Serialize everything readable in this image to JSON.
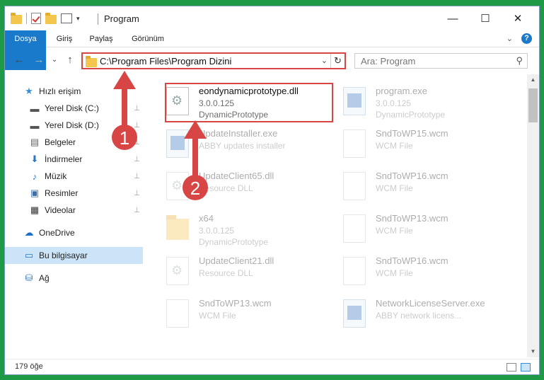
{
  "window": {
    "title": "Program",
    "controls": {
      "minimize": "—",
      "maximize": "☐",
      "close": "✕"
    }
  },
  "ribbon": {
    "tabs": [
      "Dosya",
      "Giriş",
      "Paylaş",
      "Görünüm"
    ],
    "help": "?",
    "collapse": "⌄"
  },
  "nav": {
    "back": "←",
    "forward": "→",
    "recent": "⌄",
    "up": "↑",
    "address": "C:\\Program Files\\Program Dizini",
    "address_dropdown": "⌄",
    "refresh": "↻",
    "search_placeholder": "Ara: Program",
    "search_icon": "⚲"
  },
  "sidebar": {
    "items": [
      {
        "label": "Hızlı erişim",
        "icon": "star-icon",
        "glyph": "★",
        "color": "#3b8ed6",
        "pinned": false
      },
      {
        "label": "Yerel Disk (C:)",
        "icon": "drive-icon",
        "glyph": "▬",
        "color": "#555",
        "pinned": true
      },
      {
        "label": "Yerel Disk (D:)",
        "icon": "drive-icon",
        "glyph": "▬",
        "color": "#555",
        "pinned": true
      },
      {
        "label": "Belgeler",
        "icon": "documents-icon",
        "glyph": "▤",
        "color": "#666",
        "pinned": true
      },
      {
        "label": "İndirmeler",
        "icon": "download-icon",
        "glyph": "⬇",
        "color": "#2a77c6",
        "pinned": true
      },
      {
        "label": "Müzik",
        "icon": "music-icon",
        "glyph": "♪",
        "color": "#2a77c6",
        "pinned": true
      },
      {
        "label": "Resimler",
        "icon": "pictures-icon",
        "glyph": "▣",
        "color": "#3a6ea5",
        "pinned": true
      },
      {
        "label": "Videolar",
        "icon": "video-icon",
        "glyph": "▦",
        "color": "#333",
        "pinned": true
      },
      {
        "label": "OneDrive",
        "icon": "onedrive-icon",
        "glyph": "☁",
        "color": "#1a6fc7",
        "pinned": false
      },
      {
        "label": "Bu bilgisayar",
        "icon": "computer-icon",
        "glyph": "▭",
        "color": "#2a77c6",
        "pinned": false,
        "selected": true
      },
      {
        "label": "Ağ",
        "icon": "network-icon",
        "glyph": "⛁",
        "color": "#2a77c6",
        "pinned": false
      }
    ],
    "pin_glyph": "📌"
  },
  "files": [
    {
      "name": "eondynamicprototype.dll",
      "line2": "3.0.0.125",
      "line3": "DynamicPrototype",
      "kind": "dll",
      "faded": false
    },
    {
      "name": "program.exe",
      "line2": "3.0.0.125",
      "line3": "DynamicPrototype",
      "kind": "exe",
      "faded": true
    },
    {
      "name": "UpdateInstaller.exe",
      "line2": "ABBY updates installer",
      "line3": "",
      "kind": "exe",
      "faded": true
    },
    {
      "name": "SndToWP15.wcm",
      "line2": "WCM File",
      "line3": "",
      "kind": "doc",
      "faded": true
    },
    {
      "name": "UpdateClient65.dll",
      "line2": "Resource DLL",
      "line3": "",
      "kind": "dll",
      "faded": true
    },
    {
      "name": "SndToWP16.wcm",
      "line2": "WCM File",
      "line3": "",
      "kind": "doc",
      "faded": true
    },
    {
      "name": "x64",
      "line2": "3.0.0.125",
      "line3": "DynamicPrototype",
      "kind": "folder",
      "faded": true
    },
    {
      "name": "SndToWP13.wcm",
      "line2": "WCM File",
      "line3": "",
      "kind": "doc",
      "faded": true
    },
    {
      "name": "UpdateClient21.dll",
      "line2": "Resource DLL",
      "line3": "",
      "kind": "dll",
      "faded": true
    },
    {
      "name": "SndToWP16.wcm",
      "line2": "WCM File",
      "line3": "",
      "kind": "doc",
      "faded": true
    },
    {
      "name": "SndToWP13.wcm",
      "line2": "WCM File",
      "line3": "",
      "kind": "doc",
      "faded": true
    },
    {
      "name": "NetworkLicenseServer.exe",
      "line2": "ABBY network licens...",
      "line3": "",
      "kind": "exe",
      "faded": true
    }
  ],
  "status": {
    "count": "179 öğe"
  },
  "annotations": {
    "badge1": "1",
    "badge2": "2",
    "accent": "#d84545"
  }
}
